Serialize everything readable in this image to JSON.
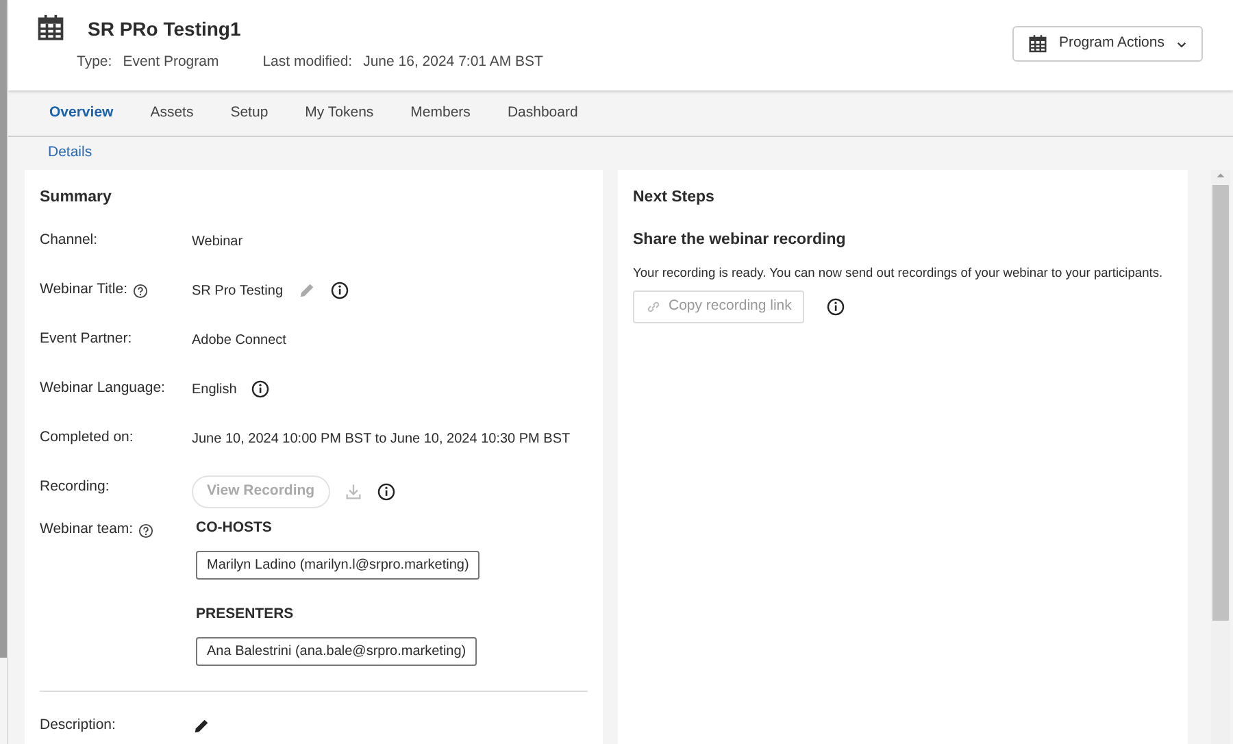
{
  "header": {
    "title": "SR PRo Testing1",
    "meta": [
      {
        "label": "Type:",
        "value": "Event Program"
      },
      {
        "label": "Last modified:",
        "value": "June 16, 2024 7:01 AM BST"
      }
    ],
    "actions_button": "Program Actions"
  },
  "tabs": [
    {
      "label": "Overview",
      "selected": true
    },
    {
      "label": "Assets",
      "selected": false
    },
    {
      "label": "Setup",
      "selected": false
    },
    {
      "label": "My Tokens",
      "selected": false
    },
    {
      "label": "Members",
      "selected": false
    },
    {
      "label": "Dashboard",
      "selected": false
    }
  ],
  "subnav": "Details",
  "summary": {
    "title": "Summary",
    "fields": [
      {
        "kind": "text",
        "label": "Channel:",
        "value": "Webinar"
      },
      {
        "kind": "text",
        "label": "Webinar Title:",
        "label_help": true,
        "value": "SR Pro Testing",
        "editable": false,
        "info": true
      },
      {
        "kind": "text",
        "label": "Event Partner:",
        "value": "Adobe Connect"
      },
      {
        "kind": "text",
        "label": "Webinar Language:",
        "value": "English",
        "info": true
      },
      {
        "kind": "text",
        "label": "Completed on:",
        "value": "June 10, 2024 10:00 PM BST to June 10, 2024 10:30 PM BST"
      },
      {
        "kind": "recording",
        "label": "Recording:",
        "button": {
          "label": "View Recording",
          "disabled": true
        },
        "download_disabled": true,
        "info": true
      },
      {
        "kind": "team",
        "label": "Webinar team:",
        "label_help": true,
        "groups": [
          {
            "heading": "CO-HOSTS",
            "members": [
              "Marilyn Ladino (marilyn.l@srpro.marketing)"
            ]
          },
          {
            "heading": "PRESENTERS",
            "members": [
              "Ana Balestrini (ana.bale@srpro.marketing)"
            ]
          }
        ]
      },
      {
        "kind": "divider"
      },
      {
        "kind": "text",
        "label": "Description:",
        "editable": true
      }
    ]
  },
  "next_steps": {
    "title": "Next Steps",
    "items": [
      {
        "heading": "Share the webinar recording",
        "text": "Your recording is ready. You can now send out recordings of your webinar to your participants.",
        "button": {
          "label": "Copy recording link",
          "disabled": true
        },
        "info": true
      }
    ]
  }
}
